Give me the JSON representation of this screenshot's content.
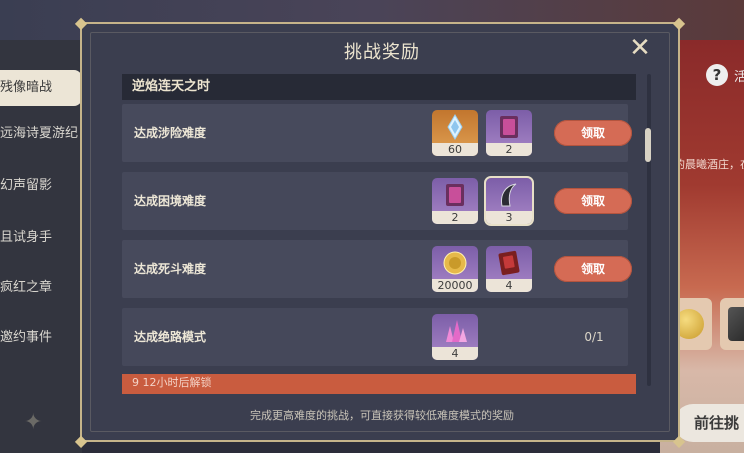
{
  "dialog": {
    "title": "挑战奖励",
    "footer_note": "完成更高难度的挑战，可直接获得较低难度模式的奖励"
  },
  "section": {
    "header": "逆焰连天之时",
    "partial_next_header": "9 12小时后解锁"
  },
  "rows": [
    {
      "label": "达成涉险难度",
      "items": [
        {
          "icon": "crystal-icon",
          "count": "60",
          "rarity": "orange"
        },
        {
          "icon": "book-icon",
          "count": "2",
          "rarity": "purple"
        }
      ],
      "action": "领取"
    },
    {
      "label": "达成困境难度",
      "items": [
        {
          "icon": "book-icon",
          "count": "2",
          "rarity": "purple"
        },
        {
          "icon": "horn-icon",
          "count": "3",
          "rarity": "purple"
        }
      ],
      "action": "领取"
    },
    {
      "label": "达成死斗难度",
      "items": [
        {
          "icon": "mora-coin-icon",
          "count": "20000",
          "rarity": "purple"
        },
        {
          "icon": "red-book-icon",
          "count": "4",
          "rarity": "purple"
        }
      ],
      "action": "领取"
    },
    {
      "label": "达成绝路模式",
      "items": [
        {
          "icon": "crystal-ore-icon",
          "count": "4",
          "rarity": "purple"
        }
      ],
      "progress": "0/1"
    }
  ],
  "sidebar": {
    "items": [
      {
        "label": "残像暗战",
        "active": true
      },
      {
        "label": "远海诗夏游纪",
        "active": false
      },
      {
        "label": "幻声留影",
        "active": false
      },
      {
        "label": "且试身手",
        "active": false
      },
      {
        "label": "疯红之章",
        "active": false
      },
      {
        "label": "邀约事件",
        "active": false
      }
    ]
  },
  "right_panel": {
    "help_text": "活",
    "desc_fragment": "的晨曦酒庄，在",
    "goto_button": "前往挑"
  },
  "colors": {
    "claim_button": "#d56b55",
    "dialog_bg": "#3b3e4f",
    "dialog_border": "#c6b48a",
    "rarity_orange": "#c2762e",
    "rarity_purple": "#7c5ea8"
  }
}
